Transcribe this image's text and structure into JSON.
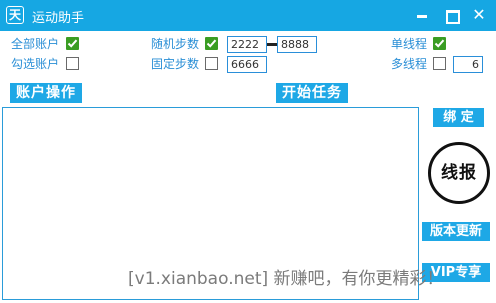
{
  "window": {
    "icon_glyph": "天",
    "title": "运动助手",
    "min_glyph": "",
    "max_glyph": "",
    "close_glyph": "✕"
  },
  "options": {
    "all_accounts": {
      "label": "全部账户",
      "checked": true
    },
    "selected_accounts": {
      "label": "勾选账户",
      "checked": false
    },
    "random_steps": {
      "label": "随机步数",
      "checked": true,
      "min": "2222",
      "max": "8888"
    },
    "fixed_steps": {
      "label": "固定步数",
      "checked": false,
      "value": "6666"
    },
    "single_thread": {
      "label": "单线程",
      "checked": true
    },
    "multi_thread": {
      "label": "多线程",
      "checked": false,
      "value": "6"
    }
  },
  "buttons": {
    "account_ops": "账户操作",
    "start_task": "开始任务",
    "bind": "绑 定",
    "report": "线报",
    "update": "版本更新",
    "vip": "VIP专享"
  },
  "watermark": "[v1.xianbao.net] 新赚吧，有你更精彩！",
  "colors": {
    "titlebar": "#16a7e3",
    "button": "#1ea8e6",
    "label_text": "#2b8fd6",
    "check_green": "#3a9d23"
  },
  "icons": {
    "checked": "check-mark-icon",
    "unchecked": "empty-box-icon"
  }
}
